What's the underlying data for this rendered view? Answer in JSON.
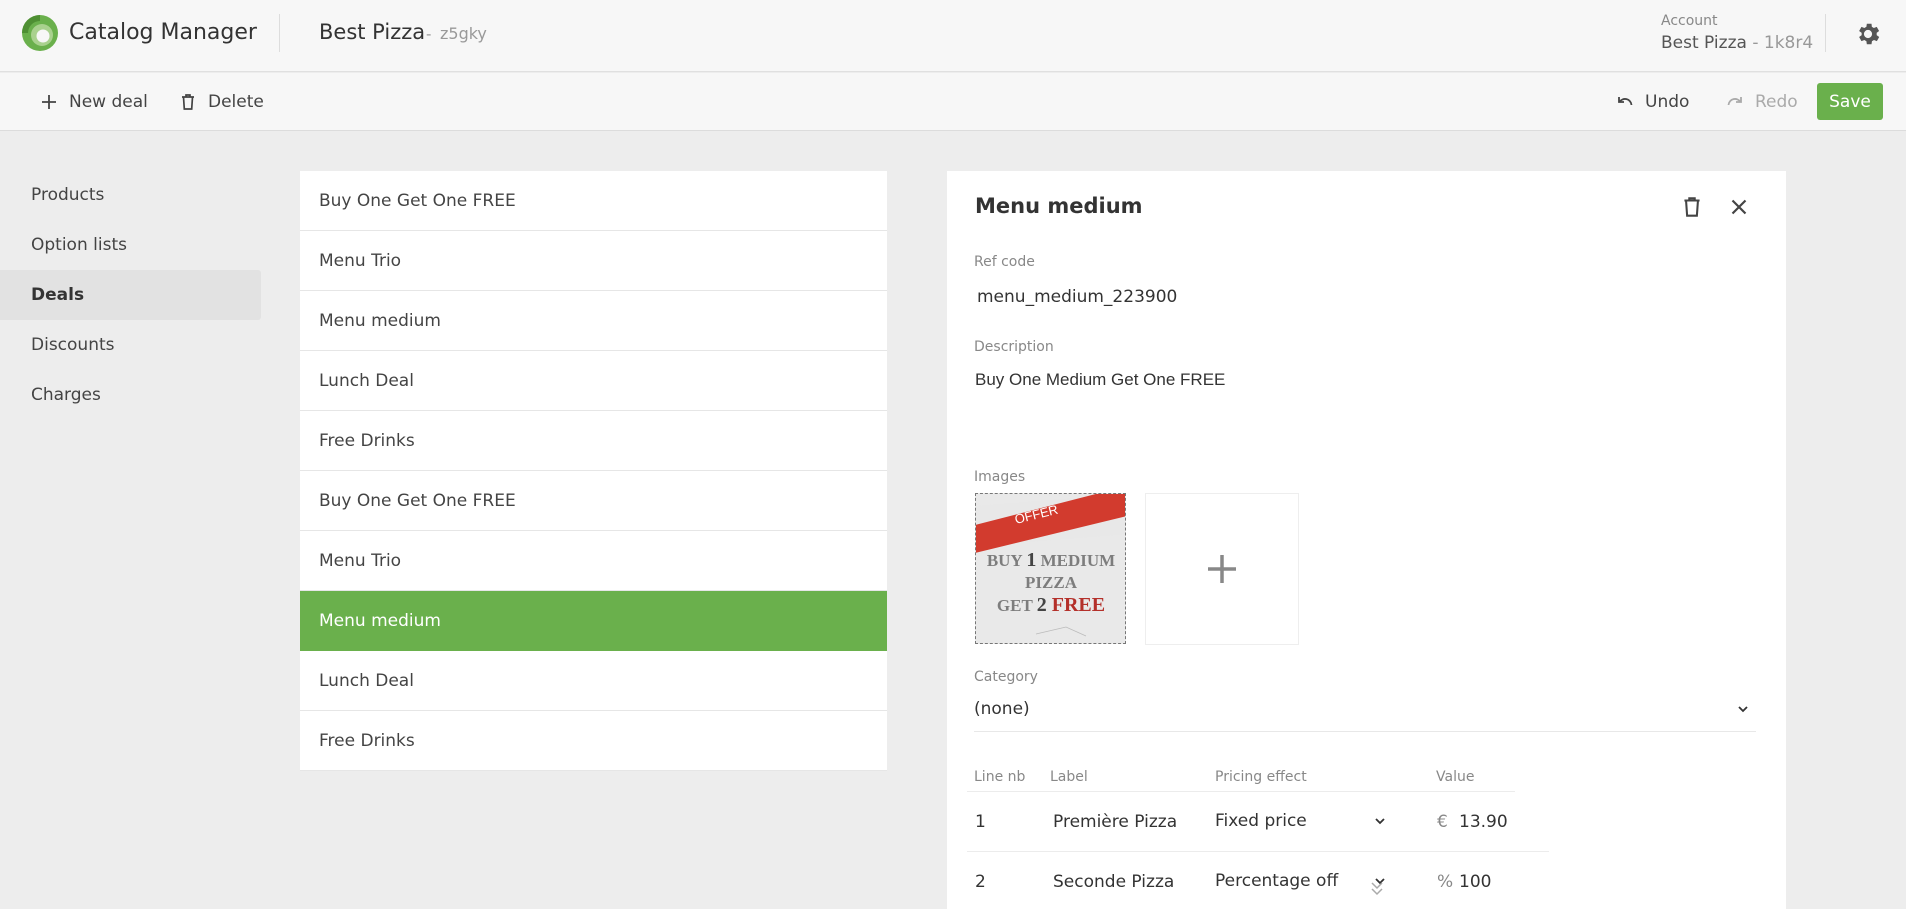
{
  "header": {
    "app_title": "Catalog Manager",
    "store_name": "Best Pizza",
    "store_separator": "-",
    "store_code": "z5gky",
    "account_label": "Account",
    "account_name": "Best Pizza",
    "account_separator": " - ",
    "account_code": "1k8r4",
    "brand_color": "#6ab04c"
  },
  "toolbar": {
    "new_label": "New deal",
    "delete_label": "Delete",
    "undo_label": "Undo",
    "redo_label": "Redo",
    "save_label": "Save"
  },
  "sidebar": {
    "items": [
      {
        "label": "Products"
      },
      {
        "label": "Option lists"
      },
      {
        "label": "Deals"
      },
      {
        "label": "Discounts"
      },
      {
        "label": "Charges"
      }
    ],
    "active": "Deals"
  },
  "deals": [
    {
      "label": "Buy One Get One FREE"
    },
    {
      "label": "Menu Trio"
    },
    {
      "label": "Menu medium"
    },
    {
      "label": "Lunch Deal"
    },
    {
      "label": "Free Drinks"
    },
    {
      "label": "Buy One Get One FREE"
    },
    {
      "label": "Menu Trio"
    },
    {
      "label": "Menu medium"
    },
    {
      "label": "Lunch Deal"
    },
    {
      "label": "Free Drinks"
    }
  ],
  "detail": {
    "title": "Menu medium",
    "ref_code_label": "Ref code",
    "ref_code": "menu_medium_223900",
    "description_label": "Description",
    "description": "Buy One Medium Get One FREE",
    "images_label": "Images",
    "image": {
      "ribbon": "OFFER",
      "line1a": "BUY ",
      "line1b": "1",
      "line1c": " MEDIUM",
      "line2": "PIZZA",
      "line3a": "GET ",
      "line3b": "2",
      "line3c": " FREE"
    },
    "add_image_symbol": "+",
    "category_label": "Category",
    "category_value": "(none)",
    "table": {
      "headers": {
        "line_nb": "Line nb",
        "label": "Label",
        "pricing": "Pricing effect",
        "value": "Value"
      },
      "rows": [
        {
          "line_nb": "1",
          "label": "Première Pizza",
          "pricing": "Fixed price",
          "unit": "€",
          "value": "13.90"
        },
        {
          "line_nb": "2",
          "label": "Seconde Pizza",
          "pricing": "Percentage off",
          "unit": "%",
          "value": "100"
        }
      ]
    }
  }
}
